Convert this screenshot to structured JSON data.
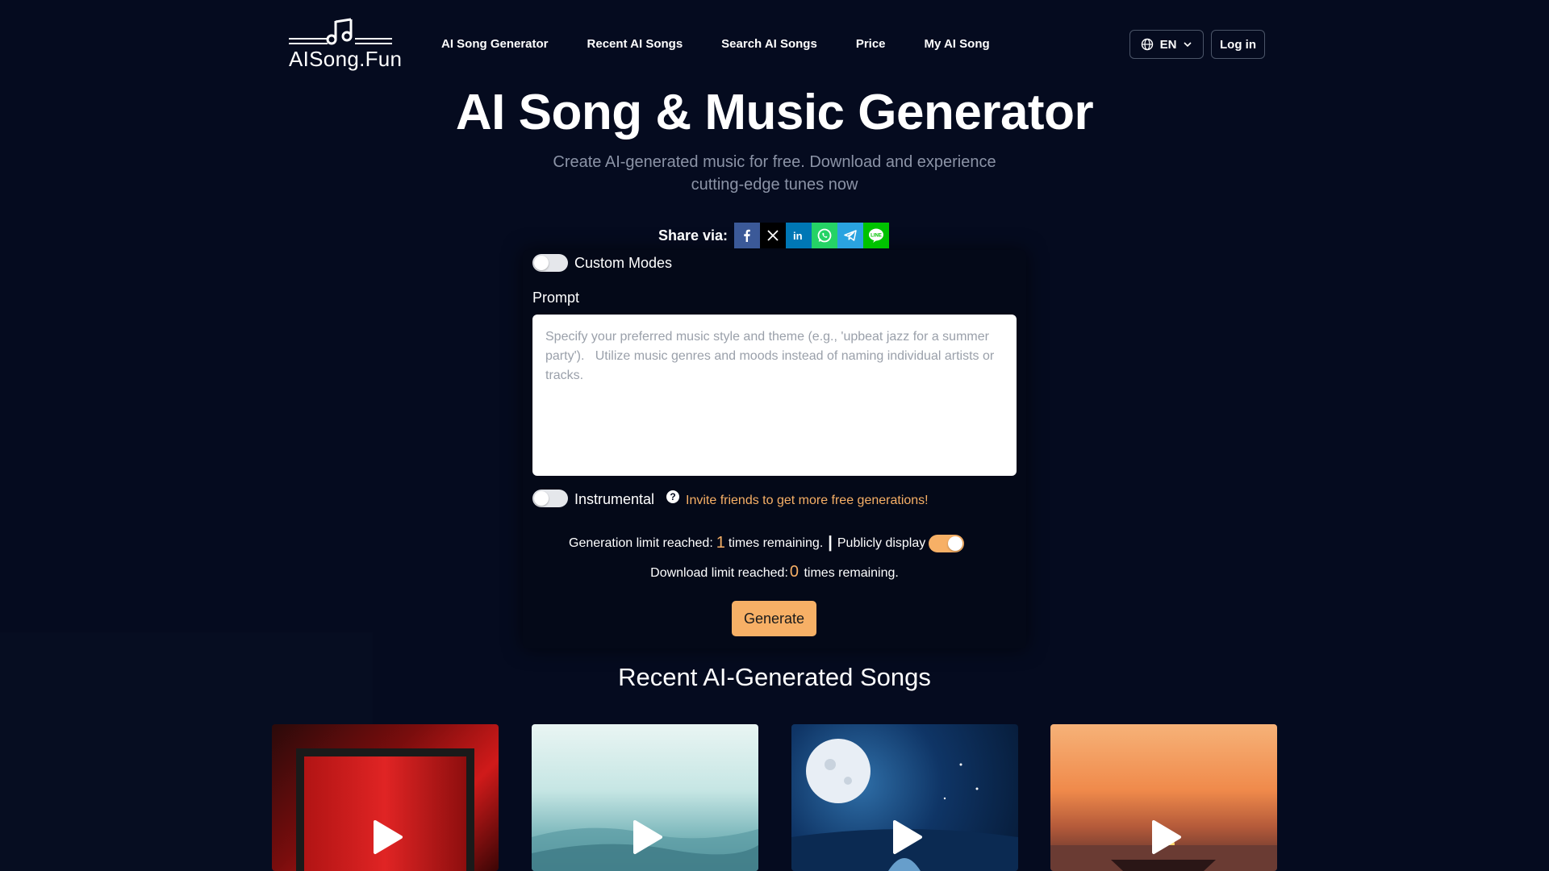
{
  "header": {
    "logo_text": "AISong.Fun",
    "nav": [
      "AI Song Generator",
      "Recent AI Songs",
      "Search AI Songs",
      "Price",
      "My AI Song"
    ],
    "lang": "EN",
    "login": "Log in"
  },
  "hero": {
    "title": "AI Song & Music Generator",
    "subtitle": "Create AI-generated music for free. Download and experience cutting-edge tunes now"
  },
  "share": {
    "label": "Share via:",
    "networks": [
      "facebook",
      "x",
      "linkedin",
      "whatsapp",
      "telegram",
      "line"
    ],
    "colors": {
      "facebook": "#3b5998",
      "x": "#000000",
      "linkedin": "#0077b5",
      "whatsapp": "#25d366",
      "telegram": "#2aa3e0",
      "line": "#00c300"
    }
  },
  "form": {
    "custom_modes_label": "Custom Modes",
    "custom_modes_on": false,
    "prompt_label": "Prompt",
    "prompt_placeholder": "Specify your preferred music style and theme (e.g., 'upbeat jazz for a summer party').   Utilize music genres and moods instead of naming individual artists or tracks.",
    "prompt_value": "",
    "instrumental_label": "Instrumental",
    "instrumental_on": false,
    "invite_text": "Invite friends to get more free generations!",
    "gen_limit_prefix": "Generation limit reached:",
    "gen_remaining": "1",
    "gen_limit_suffix": "times remaining.",
    "separator": "|",
    "public_label": "Publicly display",
    "public_on": true,
    "dl_limit_prefix": "Download limit reached:",
    "dl_remaining": "0",
    "dl_limit_suffix": "times remaining.",
    "generate_label": "Generate"
  },
  "recent": {
    "title": "Recent AI-Generated Songs",
    "cards": [
      "red-frame-artwork",
      "ocean-wave-artwork",
      "moonlit-sea-artwork",
      "sunset-boat-artwork"
    ]
  },
  "colors": {
    "background": "#050b1f",
    "accent": "#f7b066"
  }
}
